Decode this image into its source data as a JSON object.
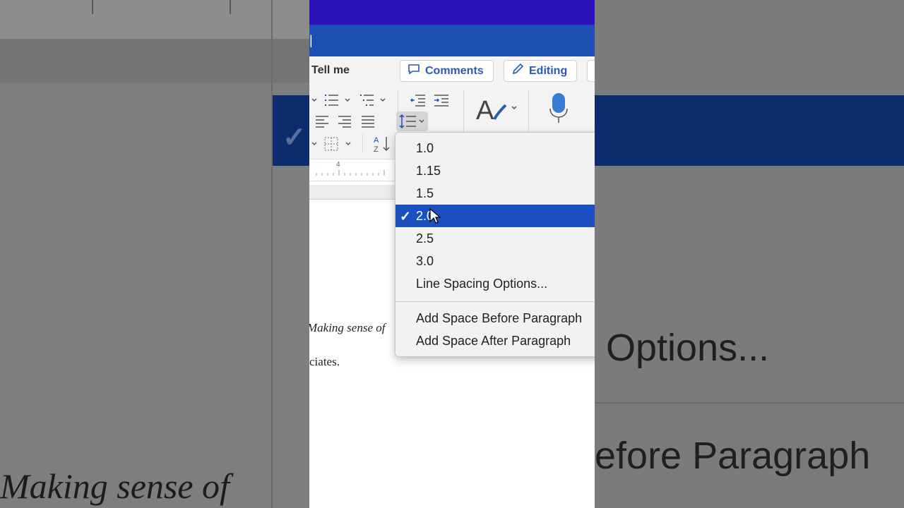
{
  "header": {
    "tell_me": "Tell me",
    "comments_label": "Comments",
    "editing_label": "Editing"
  },
  "line_spacing_menu": {
    "items": [
      {
        "label": "1.0",
        "selected": false
      },
      {
        "label": "1.15",
        "selected": false
      },
      {
        "label": "1.5",
        "selected": false
      },
      {
        "label": "2.0",
        "selected": true
      },
      {
        "label": "2.5",
        "selected": false
      },
      {
        "label": "3.0",
        "selected": false
      },
      {
        "label": "Line Spacing Options...",
        "selected": false
      }
    ],
    "paragraph_items": [
      "Add Space Before Paragraph",
      "Add Space After Paragraph"
    ]
  },
  "ruler": {
    "marker": "4"
  },
  "document": {
    "line1": "Making sense of",
    "line2": "ciates."
  },
  "background_zoom": {
    "text1": "Making sense of",
    "text2": "Options...",
    "text3": "efore Paragraph"
  },
  "colors": {
    "title_bar": "#2a13b8",
    "doc_bar": "#1e4fb5",
    "accent": "#2a5ab0",
    "selection": "#1c4fc0"
  },
  "icons": [
    "comment-icon",
    "pencil-icon",
    "bullets-icon",
    "numbering-icon",
    "multilevel-list-icon",
    "decrease-indent-icon",
    "increase-indent-icon",
    "align-left-icon",
    "align-right-icon",
    "justify-icon",
    "line-spacing-icon",
    "borders-icon",
    "sort-icon",
    "styles-icon",
    "microphone-icon",
    "checkmark-icon",
    "mouse-pointer-icon"
  ]
}
